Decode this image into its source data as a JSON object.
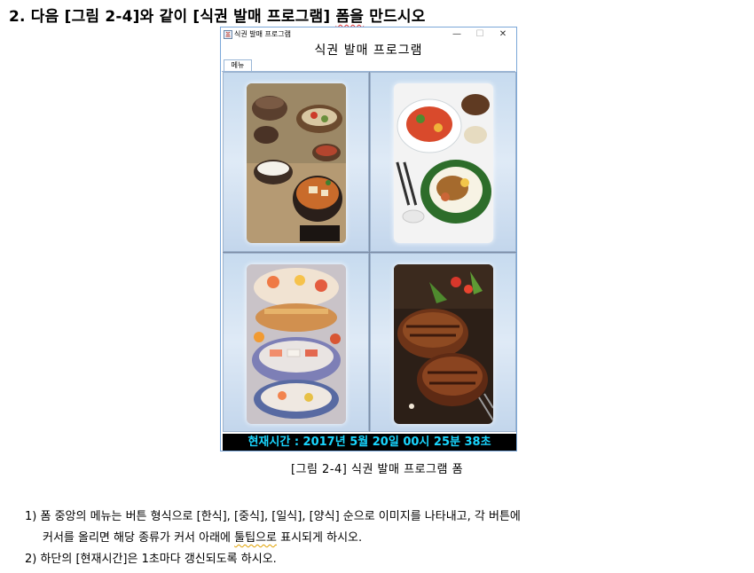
{
  "document": {
    "heading_prefix": "2. 다음 [그림 2-4]와 같이 [식권 발매 프로그램] ",
    "heading_underlined": "폼을",
    "heading_suffix": " 만드시오",
    "caption": "[그림 2-4] 식권 발매 프로그램 폼",
    "note1_a": "1) 폼 중앙의 메뉴는 버튼 형식으로 [한식], [중식], [일식], [양식] 순으로 이미지를 나타내고, 각 버튼에",
    "note1_b_pre": "커서를 올리면 해당 종류가 커서 아래에 ",
    "note1_b_under": "툴팁으로",
    "note1_b_post": " 표시되게 하시오.",
    "note2": "2) 하단의 [현재시간]은 1초마다 갱신되도록 하시오."
  },
  "window": {
    "title": "식권 발매 프로그램",
    "controls": {
      "minimize": "—",
      "maximize": "☐",
      "close": "✕"
    },
    "header": "식권 발매 프로그램",
    "tab_label": "메뉴",
    "menu_items": [
      {
        "image": "korean-food-photo"
      },
      {
        "image": "chinese-food-photo"
      },
      {
        "image": "japanese-food-photo"
      },
      {
        "image": "western-food-photo"
      }
    ],
    "status_text": "현재시간 : 2017년 5월 20일 00시 25분 38초",
    "colors": {
      "status_bg": "#000000",
      "status_fg": "#19d6ff",
      "cell_bg": "#d3e3f3"
    }
  }
}
